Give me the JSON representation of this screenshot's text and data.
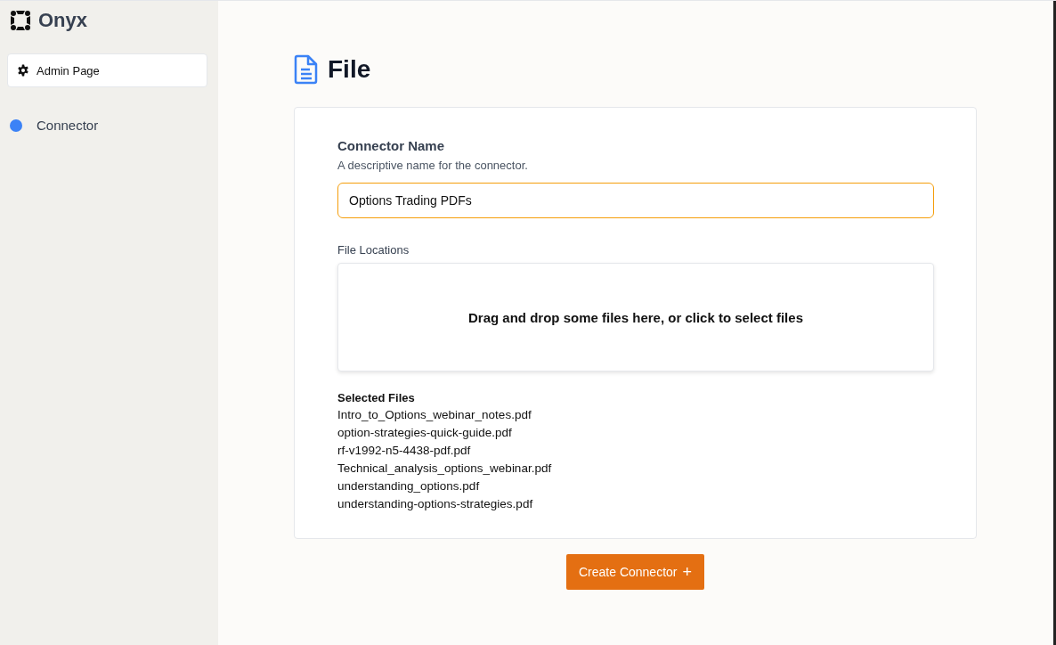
{
  "sidebar": {
    "brand": "Onyx",
    "admin_button": "Admin Page",
    "items": [
      {
        "label": "Connector",
        "color": "#3b82f6"
      }
    ]
  },
  "page": {
    "title": "File"
  },
  "form": {
    "name_label": "Connector Name",
    "name_description": "A descriptive name for the connector.",
    "name_value": "Options Trading PDFs",
    "locations_label": "File Locations",
    "dropzone_text": "Drag and drop some files here, or click to select files",
    "selected_heading": "Selected Files",
    "selected_files": [
      "Intro_to_Options_webinar_notes.pdf",
      "option-strategies-quick-guide.pdf",
      "rf-v1992-n5-4438-pdf.pdf",
      "Technical_analysis_options_webinar.pdf",
      "understanding_options.pdf",
      "understanding-options-strategies.pdf"
    ]
  },
  "submit_button": {
    "label": "Create Connector",
    "icon": "+"
  }
}
